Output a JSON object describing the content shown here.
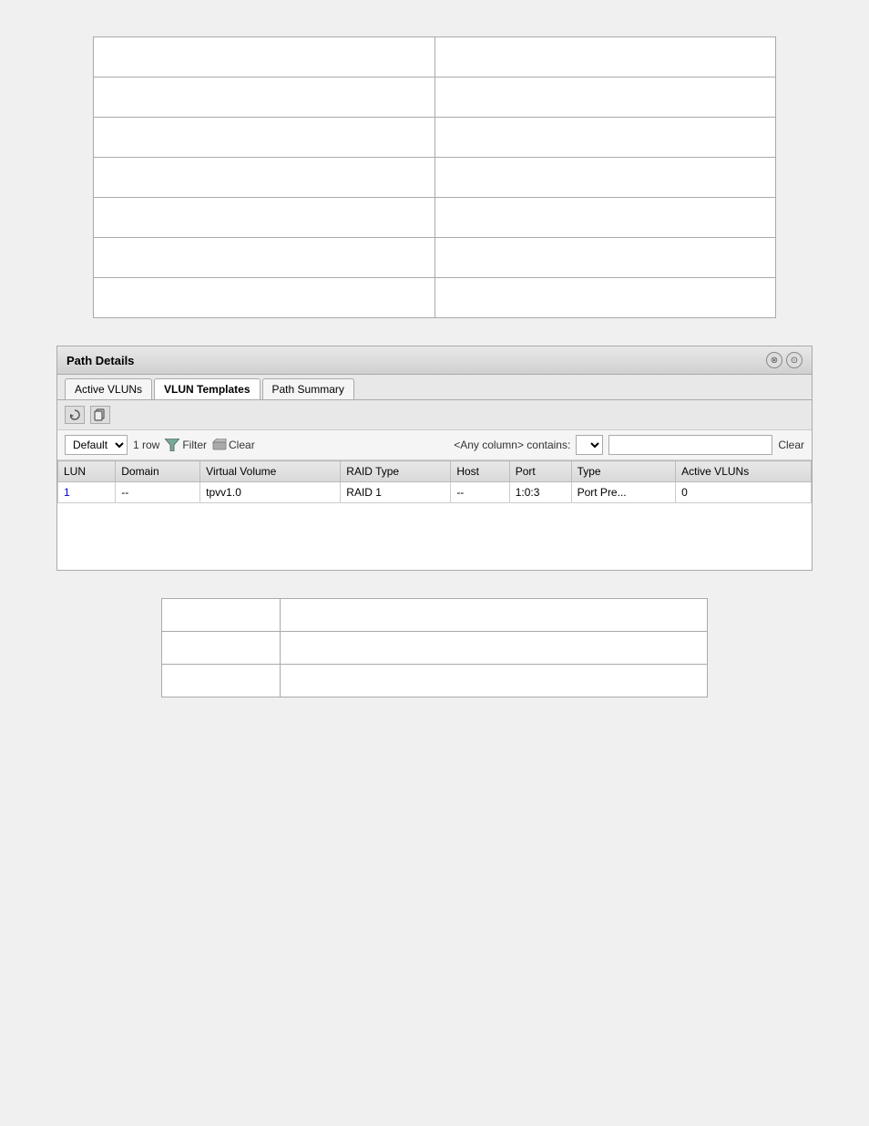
{
  "topTable": {
    "rows": [
      [
        "",
        ""
      ],
      [
        "",
        ""
      ],
      [
        "",
        ""
      ],
      [
        "",
        ""
      ],
      [
        "",
        ""
      ],
      [
        "",
        ""
      ],
      [
        "",
        ""
      ]
    ]
  },
  "pathDetails": {
    "title": "Path Details",
    "icons": {
      "collapse": "⊗",
      "settings": "⊙"
    },
    "tabs": [
      {
        "label": "Active VLUNs",
        "active": false
      },
      {
        "label": "VLUN Templates",
        "active": true
      },
      {
        "label": "Path Summary",
        "active": false
      }
    ],
    "toolbar": {
      "refreshLabel": "🔄",
      "copyLabel": "📋"
    },
    "filter": {
      "defaultOption": "Default",
      "rowCount": "1 row",
      "filterLabel": "Filter",
      "clearLabel": "Clear",
      "anyColumnLabel": "<Any column> contains:",
      "clearRightLabel": "Clear",
      "searchPlaceholder": ""
    },
    "columns": [
      {
        "label": "LUN"
      },
      {
        "label": "Domain"
      },
      {
        "label": "Virtual\nVolume"
      },
      {
        "label": "RAID Type"
      },
      {
        "label": "Host"
      },
      {
        "label": "Port"
      },
      {
        "label": "Type"
      },
      {
        "label": "Active\nVLUNs"
      }
    ],
    "rows": [
      {
        "lun": "1",
        "domain": "--",
        "virtualVolume": "tpvv1.0",
        "raidType": "RAID 1",
        "host": "--",
        "port": "1:0:3",
        "type": "Port Pre...",
        "activeVluns": "0"
      }
    ]
  },
  "bottomTable": {
    "rows": [
      [
        "",
        ""
      ],
      [
        "",
        ""
      ],
      [
        "",
        ""
      ]
    ]
  }
}
